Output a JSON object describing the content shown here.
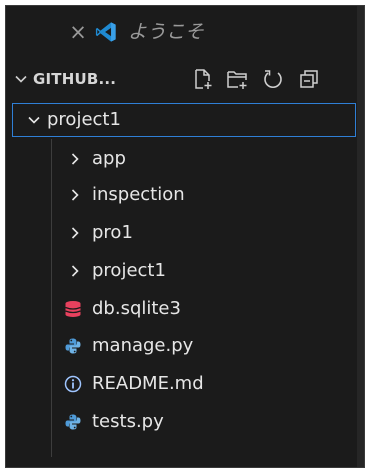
{
  "open_editors": {
    "close_glyph": "×",
    "welcome_label": "ようこそ",
    "logo_icon": "vscode-logo-icon"
  },
  "explorer": {
    "section_title": "GITHUB...",
    "actions": [
      "new-file-icon",
      "new-folder-icon",
      "refresh-icon",
      "collapse-all-icon"
    ],
    "root_folder": "project1",
    "items": [
      {
        "label": "app",
        "kind": "folder"
      },
      {
        "label": "inspection",
        "kind": "folder"
      },
      {
        "label": "pro1",
        "kind": "folder"
      },
      {
        "label": "project1",
        "kind": "folder"
      },
      {
        "label": "db.sqlite3",
        "kind": "database",
        "icon": "database-icon"
      },
      {
        "label": "manage.py",
        "kind": "python",
        "icon": "python-icon"
      },
      {
        "label": "README.md",
        "kind": "markdown",
        "icon": "info-icon"
      },
      {
        "label": "tests.py",
        "kind": "python",
        "icon": "python-icon"
      }
    ]
  },
  "colors": {
    "background": "#1b1b1b",
    "text": "#e6e6e6",
    "muted_text": "#9a9a9a",
    "focus_border": "#2f7fd6",
    "database": "#e8415e",
    "python": "#4f9bd8",
    "info": "#9fc5ff"
  }
}
